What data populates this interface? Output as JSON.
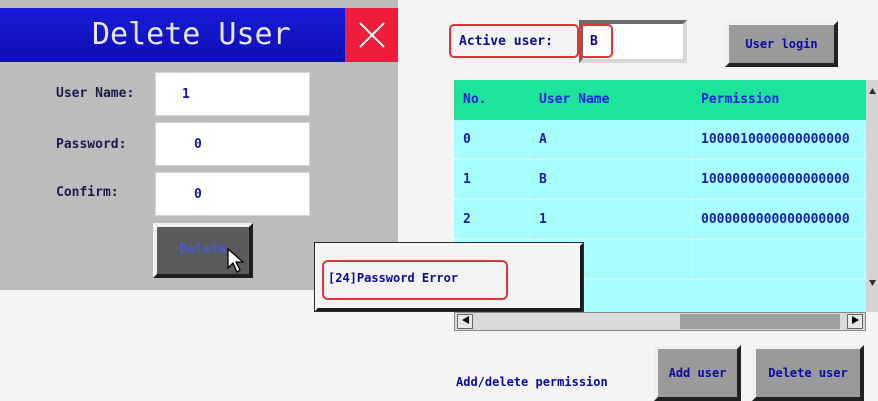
{
  "dialog": {
    "title": "Delete User",
    "fields": [
      {
        "label": "User Name:",
        "value": "1"
      },
      {
        "label": "Password:",
        "value": "0"
      },
      {
        "label": "Confirm:",
        "value": "0"
      }
    ],
    "delete_label": "Delete"
  },
  "active_user": {
    "label": "Active user:",
    "value": "B"
  },
  "login_label": "User login",
  "table": {
    "columns": [
      "No.",
      "User Name",
      "Permission"
    ],
    "rows": [
      [
        "0",
        "A",
        "1000010000000000000"
      ],
      [
        "1",
        "B",
        "1000000000000000000"
      ],
      [
        "2",
        "1",
        "0000000000000000000"
      ]
    ]
  },
  "error_message": "[24]Password Error",
  "bottom": {
    "permission_label": "Add/delete permission",
    "add_user_label": "Add user",
    "delete_user_label": "Delete user"
  },
  "colors": {
    "title_bar": "#1414c8",
    "close": "#ee1d3c",
    "table_header": "#1ce49a",
    "table_body": "#a8ffff",
    "highlight": "#e03535"
  },
  "icons": [
    "close-icon",
    "mouse-pointer-icon",
    "arrow-left-icon",
    "arrow-right-icon",
    "arrow-up-icon",
    "arrow-down-icon"
  ]
}
